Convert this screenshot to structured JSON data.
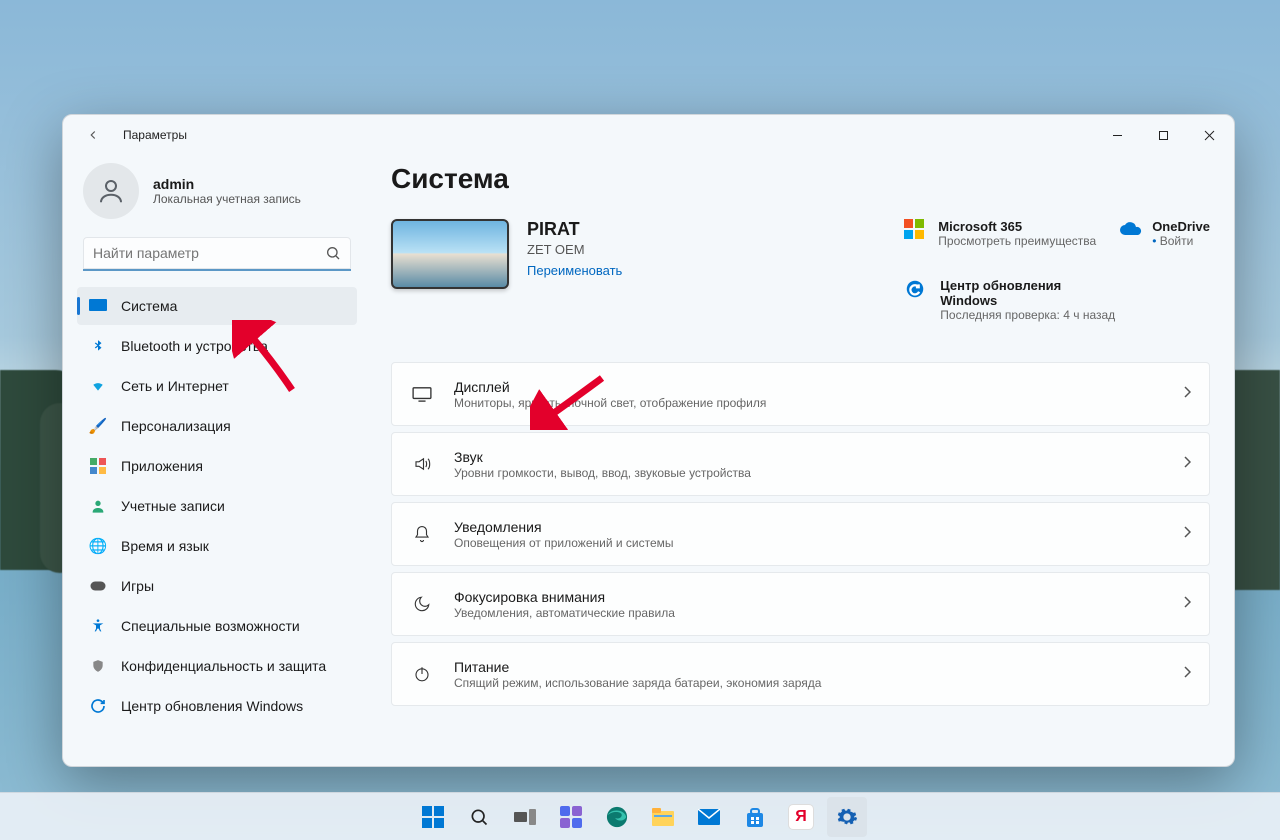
{
  "window": {
    "app_title": "Параметры"
  },
  "user": {
    "name": "admin",
    "subtitle": "Локальная учетная запись"
  },
  "search": {
    "placeholder": "Найти параметр"
  },
  "sidebar": {
    "items": [
      {
        "label": "Система"
      },
      {
        "label": "Bluetooth и устройства"
      },
      {
        "label": "Сеть и Интернет"
      },
      {
        "label": "Персонализация"
      },
      {
        "label": "Приложения"
      },
      {
        "label": "Учетные записи"
      },
      {
        "label": "Время и язык"
      },
      {
        "label": "Игры"
      },
      {
        "label": "Специальные возможности"
      },
      {
        "label": "Конфиденциальность и защита"
      },
      {
        "label": "Центр обновления Windows"
      }
    ]
  },
  "page": {
    "title": "Система",
    "device": {
      "name": "PIRAT",
      "model": "ZET OEM",
      "rename": "Переименовать"
    },
    "promo": {
      "m365": {
        "title": "Microsoft 365",
        "sub": "Просмотреть преимущества"
      },
      "onedrive": {
        "title": "OneDrive",
        "sub": "Войти"
      },
      "update": {
        "title": "Центр обновления Windows",
        "sub": "Последняя проверка: 4 ч назад"
      }
    },
    "cards": [
      {
        "title": "Дисплей",
        "sub": "Мониторы, яркость, ночной свет, отображение профиля"
      },
      {
        "title": "Звук",
        "sub": "Уровни громкости, вывод, ввод, звуковые устройства"
      },
      {
        "title": "Уведомления",
        "sub": "Оповещения от приложений и системы"
      },
      {
        "title": "Фокусировка внимания",
        "sub": "Уведомления, автоматические правила"
      },
      {
        "title": "Питание",
        "sub": "Спящий режим, использование заряда батареи, экономия заряда"
      }
    ]
  }
}
